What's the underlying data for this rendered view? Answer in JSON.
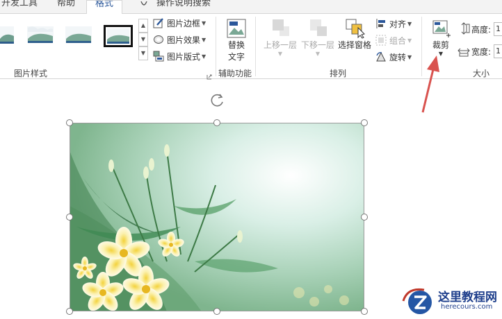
{
  "tabs": [
    {
      "label": "开发工具",
      "active": false
    },
    {
      "label": "帮助",
      "active": false
    },
    {
      "label": "格式",
      "active": true
    },
    {
      "label": "操作说明搜索",
      "active": false
    }
  ],
  "tellme_icon": "lightbulb-icon",
  "ribbon": {
    "picture_styles": {
      "label": "图片样式",
      "border": "图片边框",
      "effects": "图片效果",
      "layout": "图片版式"
    },
    "accessibility": {
      "label": "辅助功能",
      "alt_text_line1": "替换",
      "alt_text_line2": "文字"
    },
    "arrange": {
      "label": "排列",
      "bring_forward": "上移一层",
      "send_backward": "下移一层",
      "selection_pane": "选择窗格",
      "align": "对齐",
      "group": "组合",
      "rotate": "旋转"
    },
    "size": {
      "label": "大小",
      "crop": "裁剪",
      "height_label": "高度:",
      "width_label": "宽度:",
      "height_value": "1",
      "width_value": "1"
    }
  },
  "colors": {
    "accent": "#2b579a",
    "annotation_arrow": "#d9534f"
  },
  "watermark": {
    "title": "这里教程网",
    "url": "herecours.com"
  }
}
